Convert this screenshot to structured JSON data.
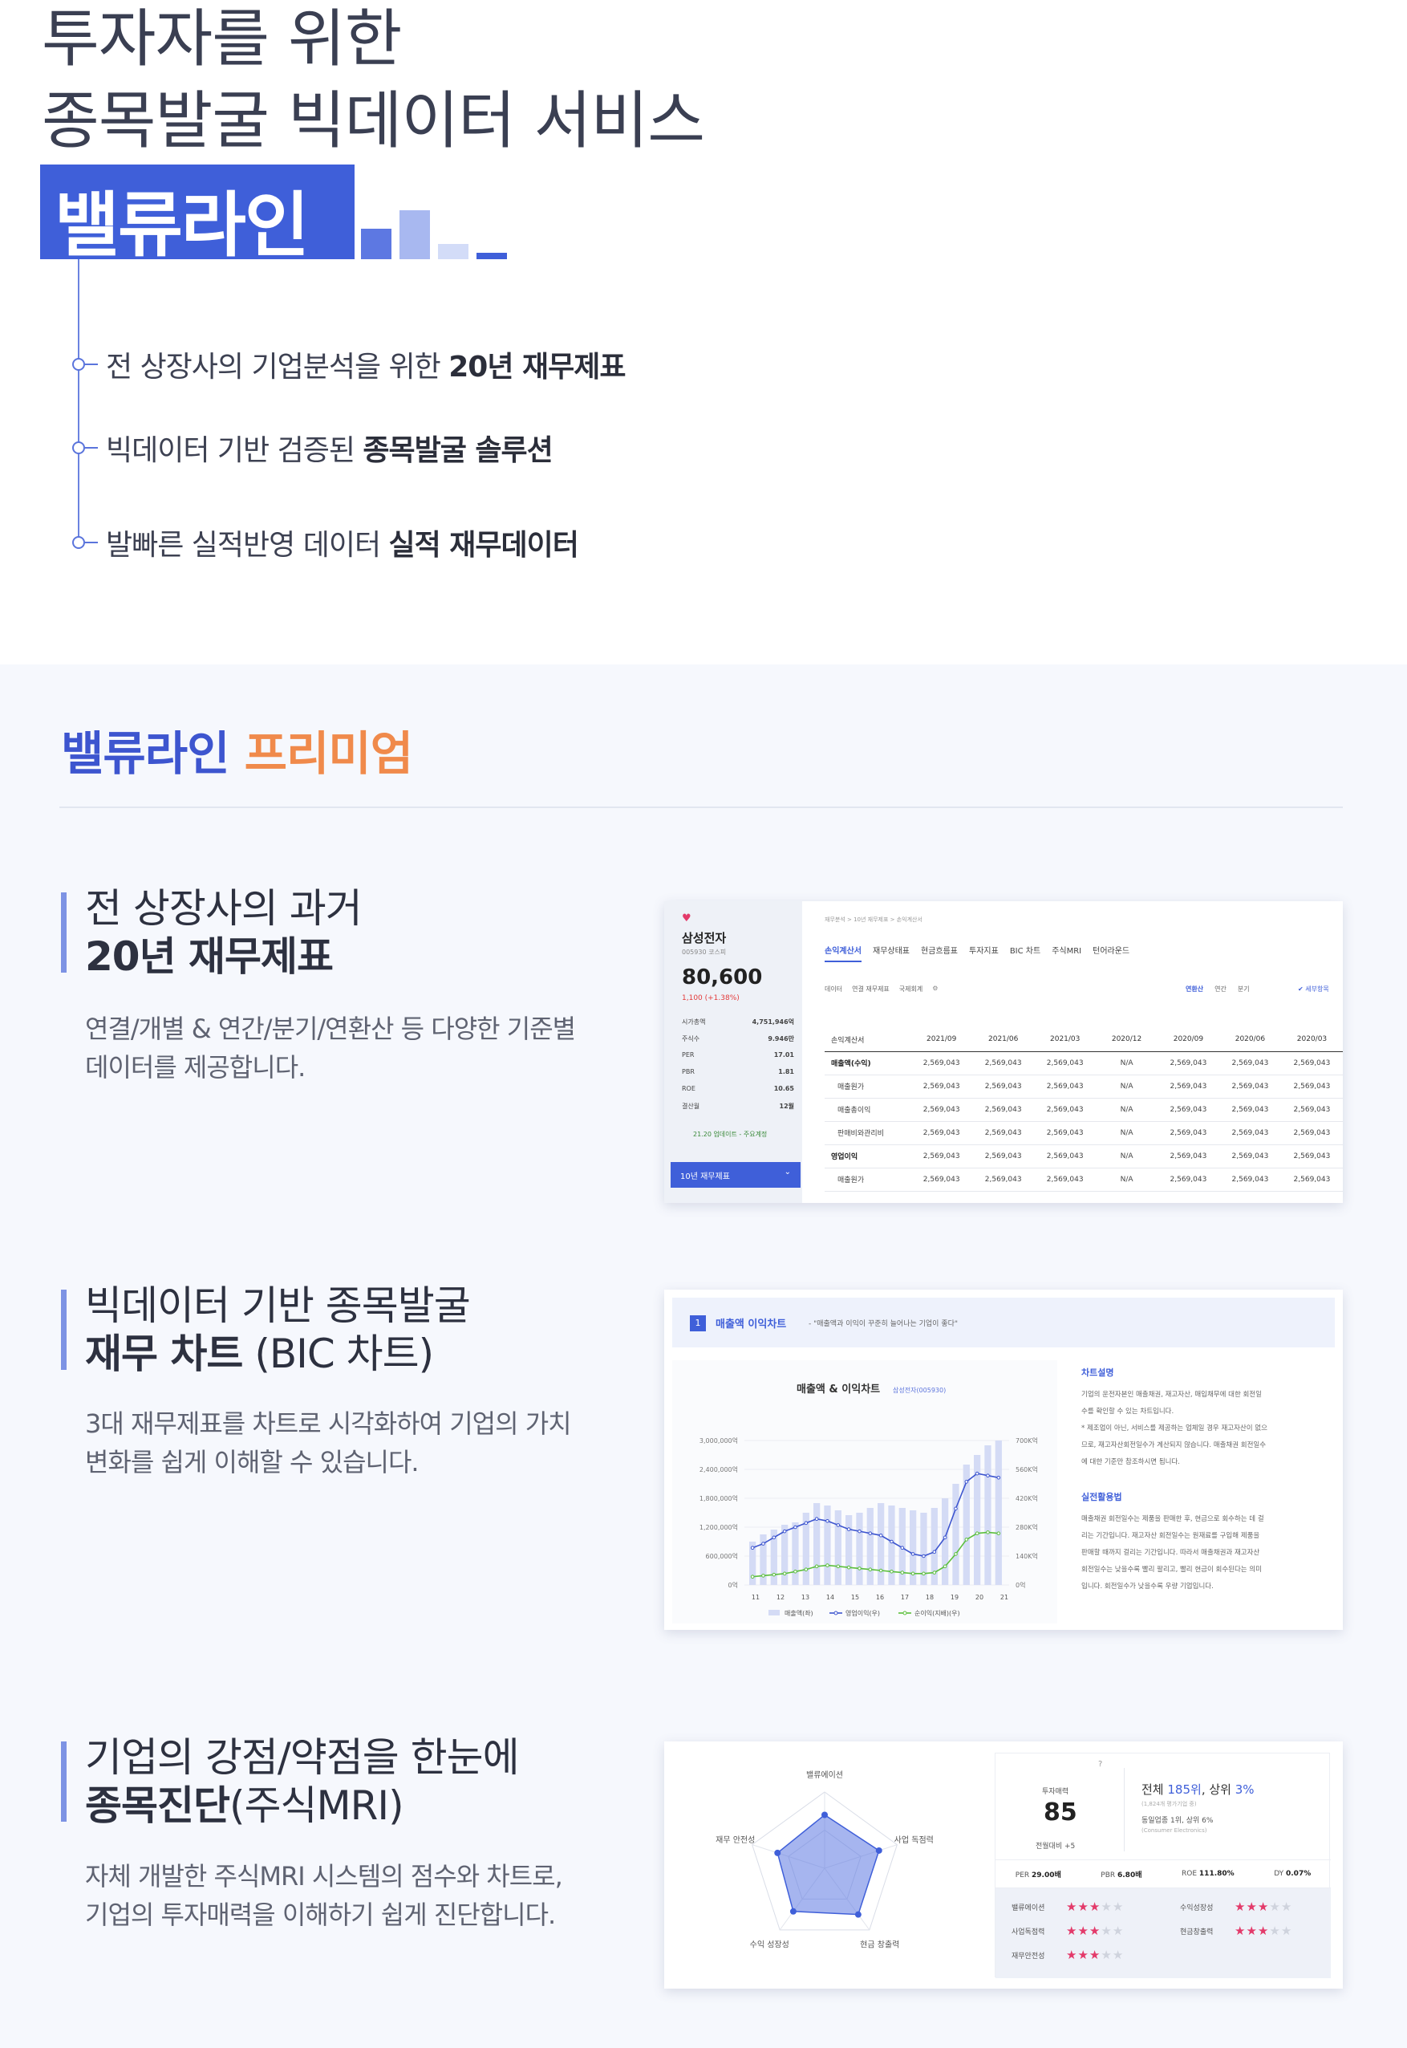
{
  "hero": {
    "line1": "투자자를 위한",
    "line2": "종목발굴 빅데이터 서비스",
    "brand": "밸류라인",
    "features": [
      {
        "plain": "전 상장사의 기업분석을 위한 ",
        "bold": "20년 재무제표"
      },
      {
        "plain": "빅데이터 기반 검증된 ",
        "bold": "종목발굴 솔루션"
      },
      {
        "plain": "발빠른 실적반영 데이터 ",
        "bold": "실적 재무데이터"
      }
    ],
    "colors": {
      "brand_blue": "#3f5fd9",
      "premium_orange": "#f08a4b"
    }
  },
  "premium": {
    "title_a": "밸류라인",
    "title_b": "프리미엄"
  },
  "sections": [
    {
      "title_l1": "전 상장사의 과거",
      "title_l2_bold": "20년 재무제표",
      "title_l2_rest": "",
      "desc_l1": "연결/개별 & 연간/분기/연환산 등 다양한 기준별",
      "desc_l2": "데이터를 제공합니다."
    },
    {
      "title_l1": "빅데이터 기반 종목발굴",
      "title_l2_bold": "재무 차트",
      "title_l2_rest": " (BIC 차트)",
      "desc_l1": "3대 재무제표를 차트로 시각화하여 기업의 가치",
      "desc_l2": "변화를 쉽게 이해할 수 있습니다."
    },
    {
      "title_l1": "기업의 강점/약점을 한눈에",
      "title_l2_bold": "종목진단",
      "title_l2_rest": "(주식MRI)",
      "desc_l1": "자체 개발한 주식MRI 시스템의 점수와 차트로,",
      "desc_l2": "기업의 투자매력을 이해하기 쉽게 진단합니다."
    }
  ],
  "table_card": {
    "company": "삼성전자",
    "code": "005930 코스피",
    "price": "80,600",
    "change": "1,100 (+1.38%)",
    "stats": [
      {
        "k": "시가총액",
        "v": "4,751,946억"
      },
      {
        "k": "주식수",
        "v": "9.946만"
      },
      {
        "k": "PER",
        "v": "17.01"
      },
      {
        "k": "PBR",
        "v": "1.81"
      },
      {
        "k": "ROE",
        "v": "10.65"
      },
      {
        "k": "결산월",
        "v": "12월"
      }
    ],
    "update_note": "21.20 업데이트 - 주요계정",
    "select_label": "10년 재무제표",
    "breadcrumb": "재무분석 > 10년 재무제표 > 손익계산서",
    "tabs": [
      "손익계산서",
      "재무상태표",
      "현금흐름표",
      "투자지표",
      "BIC 차트",
      "주식MRI",
      "턴어라운드"
    ],
    "filters": [
      "데이터",
      "연결 재무제표",
      "국제회계"
    ],
    "period_buttons": [
      "연환산",
      "연간",
      "분기"
    ],
    "detail_label": "세부항목",
    "columns": [
      "손익계산서",
      "2021/09",
      "2021/06",
      "2021/03",
      "2020/12",
      "2020/09",
      "2020/06",
      "2020/03"
    ],
    "rows": [
      {
        "label": "매출액(수익)",
        "vals": [
          "2,569,043",
          "2,569,043",
          "2,569,043",
          "N/A",
          "2,569,043",
          "2,569,043",
          "2,569,043"
        ]
      },
      {
        "label": "매출원가",
        "vals": [
          "2,569,043",
          "2,569,043",
          "2,569,043",
          "N/A",
          "2,569,043",
          "2,569,043",
          "2,569,043"
        ]
      },
      {
        "label": "매출총이익",
        "vals": [
          "2,569,043",
          "2,569,043",
          "2,569,043",
          "N/A",
          "2,569,043",
          "2,569,043",
          "2,569,043"
        ]
      },
      {
        "label": "판매비와관리비",
        "vals": [
          "2,569,043",
          "2,569,043",
          "2,569,043",
          "N/A",
          "2,569,043",
          "2,569,043",
          "2,569,043"
        ]
      },
      {
        "label": "영업이익",
        "vals": [
          "2,569,043",
          "2,569,043",
          "2,569,043",
          "N/A",
          "2,569,043",
          "2,569,043",
          "2,569,043"
        ]
      },
      {
        "label": "매출원가",
        "vals": [
          "2,569,043",
          "2,569,043",
          "2,569,043",
          "N/A",
          "2,569,043",
          "2,569,043",
          "2,569,043"
        ]
      }
    ]
  },
  "bic_card": {
    "badge": "1",
    "head_title": "매출액 이익차트",
    "head_quote": "- \"매출액과 이익이 꾸준히 늘어나는 기업이 좋다\"",
    "chart_title": "매출액 & 이익차트",
    "chart_sub": "삼성전자(005930)",
    "desc1_title": "차트설명",
    "desc1_lines": [
      "기업의 운전자본인 매출채권, 재고자산, 매입채무에 대한 회전일",
      "수를 확인할 수 있는 차트입니다.",
      "* 제조업이 아닌, 서비스를 제공하는 업체일 경우 재고자산이 없으",
      "므로, 재고자산회전일수가 계산되지 않습니다. 매출채권 회전일수",
      "에 대한 기준만 참조하시면 됩니다."
    ],
    "desc2_title": "실전활용법",
    "desc2_lines": [
      "매출채권 회전일수는 제품을 판매한 후, 현금으로 회수하는 데 걸",
      "리는 기간입니다. 재고자산 회전일수는 원재료를 구입해 제품을",
      "판매할 때까지 걸리는 기간입니다. 따라서 매출채권과 재고자산",
      "회전일수는 낮을수록 빨리 팔리고, 빨리 현금이 회수된다는 의미",
      "입니다. 회전일수가 낮을수록 우량 기업입니다."
    ]
  },
  "chart_data": {
    "type": "bar",
    "title": "매출액 & 이익차트",
    "subtitle": "삼성전자(005930)",
    "categories": [
      "11",
      "12",
      "13",
      "14",
      "15",
      "16",
      "17",
      "18",
      "19",
      "20",
      "21"
    ],
    "y_left_ticks": [
      "3,000,000억",
      "2,400,000억",
      "1,800,000억",
      "1,200,000억",
      "600,000억",
      "0억"
    ],
    "y_right_ticks": [
      "700K억",
      "560K억",
      "420K억",
      "280K억",
      "140K억",
      "0억"
    ],
    "ylim_left": [
      0,
      3000000
    ],
    "ylim_right": [
      0,
      700000
    ],
    "series": [
      {
        "name": "매출액(좌)",
        "type": "bar",
        "color": "#d4dbf5",
        "values": [
          900000,
          1050000,
          1150000,
          1250000,
          1300000,
          1500000,
          1700000,
          1650000,
          1550000,
          1450000,
          1500000,
          1600000,
          1700000,
          1650000,
          1600000,
          1550000,
          1500000,
          1600000,
          1800000,
          2100000,
          2500000,
          2700000,
          2900000,
          3000000
        ]
      },
      {
        "name": "영업이익(우)",
        "type": "line",
        "color": "#3d55cf",
        "values": [
          180000,
          200000,
          230000,
          260000,
          280000,
          300000,
          320000,
          310000,
          290000,
          270000,
          260000,
          250000,
          240000,
          210000,
          180000,
          150000,
          140000,
          160000,
          230000,
          370000,
          500000,
          540000,
          530000,
          520000
        ]
      },
      {
        "name": "순이익(지배)(우)",
        "type": "line",
        "color": "#5bbf3c",
        "values": [
          40000,
          45000,
          50000,
          55000,
          65000,
          75000,
          90000,
          95000,
          90000,
          85000,
          80000,
          75000,
          70000,
          65000,
          60000,
          55000,
          55000,
          60000,
          90000,
          150000,
          220000,
          250000,
          255000,
          250000
        ]
      }
    ]
  },
  "mri_card": {
    "radar_labels": [
      "밸류에이션",
      "사업 독점력",
      "현금 창출력",
      "수익 성장성",
      "재무 안전성"
    ],
    "radar_values": [
      0.7,
      0.75,
      0.75,
      0.7,
      0.65
    ],
    "score_label": "투자매력",
    "score": "85",
    "score_delta": "전월대비 +5",
    "rank_prefix": "전체 ",
    "rank_num": "185위",
    "rank_mid": ", 상위 ",
    "rank_pct": "3%",
    "rank_sub": "(1,824개 평가기업 중)",
    "industry_rank": "동일업종 1위, 상위 6%",
    "industry_name": "(Consumer Electronics)",
    "metrics": [
      {
        "k": "PER",
        "v": "29.00배"
      },
      {
        "k": "PBR",
        "v": "6.80배"
      },
      {
        "k": "ROE",
        "v": "111.80%"
      },
      {
        "k": "DY",
        "v": "0.07%"
      }
    ],
    "ratings": [
      {
        "k": "밸류에이션",
        "stars": 3
      },
      {
        "k": "수익성장성",
        "stars": 3
      },
      {
        "k": "사업독점력",
        "stars": 3
      },
      {
        "k": "현금창출력",
        "stars": 3
      },
      {
        "k": "재무안전성",
        "stars": 3
      }
    ]
  }
}
